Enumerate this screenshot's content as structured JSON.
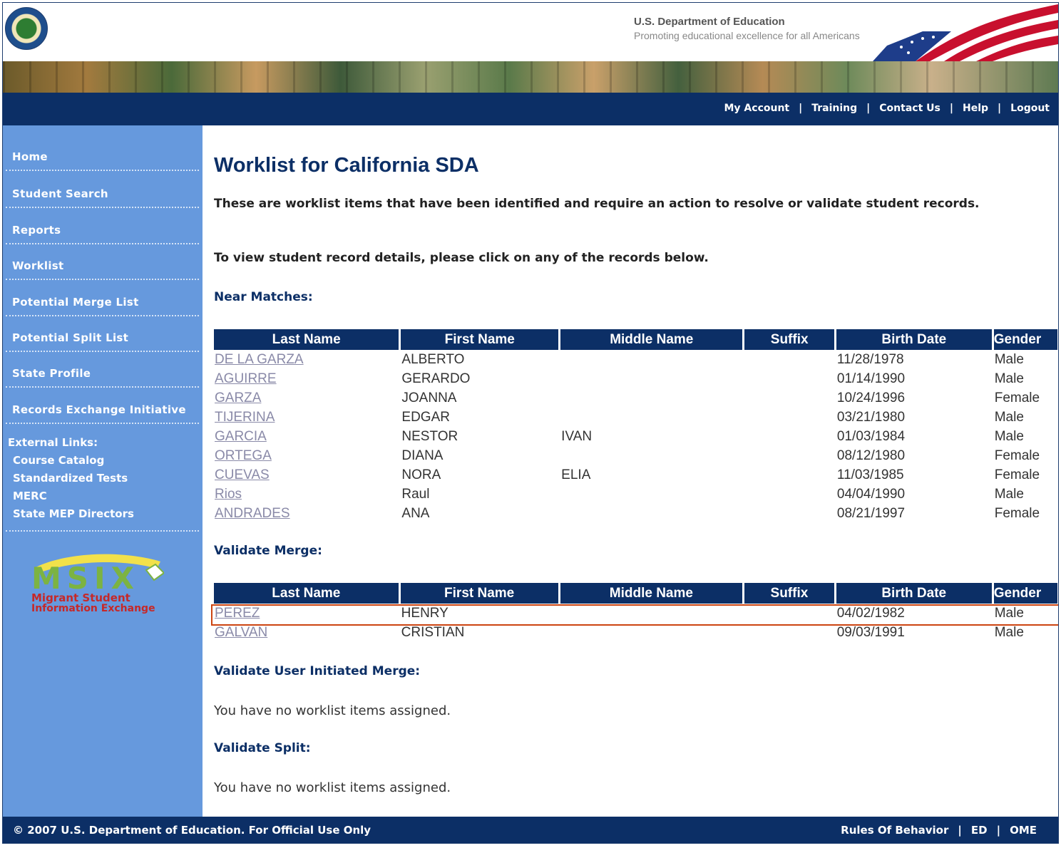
{
  "header": {
    "agency_title": "U.S. Department of Education",
    "tagline": "Promoting educational excellence for all Americans"
  },
  "topnav": {
    "links": [
      "My Account",
      "Training",
      "Contact Us",
      "Help",
      "Logout"
    ],
    "separator": "|"
  },
  "sidebar": {
    "items": [
      "Home",
      "Student Search",
      "Reports",
      "Worklist",
      "Potential Merge List",
      "Potential Split List",
      "State Profile",
      "Records Exchange Initiative"
    ],
    "external_title": "External Links:",
    "external_links": [
      "Course Catalog",
      "Standardized Tests",
      "MERC",
      "State MEP Directors"
    ],
    "logo": {
      "text": "MSIX",
      "line1": "Migrant Student",
      "line2": "Information Exchange"
    }
  },
  "main": {
    "title": "Worklist for California SDA",
    "intro": "These are worklist items that have been identified and require an action to resolve or validate student records.",
    "instructions": "To view student record details, please click on any of the records below.",
    "columns": [
      "Last Name",
      "First Name",
      "Middle Name",
      "Suffix",
      "Birth Date",
      "Gender"
    ],
    "near_matches": {
      "heading": "Near Matches:",
      "rows": [
        [
          "DE LA GARZA",
          "ALBERTO",
          "",
          "",
          "11/28/1978",
          "Male"
        ],
        [
          "AGUIRRE",
          "GERARDO",
          "",
          "",
          "01/14/1990",
          "Male"
        ],
        [
          "GARZA",
          "JOANNA",
          "",
          "",
          "10/24/1996",
          "Female"
        ],
        [
          "TIJERINA",
          "EDGAR",
          "",
          "",
          "03/21/1980",
          "Male"
        ],
        [
          "GARCIA",
          "NESTOR",
          "IVAN",
          "",
          "01/03/1984",
          "Male"
        ],
        [
          "ORTEGA",
          "DIANA",
          "",
          "",
          "08/12/1980",
          "Female"
        ],
        [
          "CUEVAS",
          "NORA",
          "ELIA",
          "",
          "11/03/1985",
          "Female"
        ],
        [
          "Rios",
          "Raul",
          "",
          "",
          "04/04/1990",
          "Male"
        ],
        [
          "ANDRADES",
          "ANA",
          "",
          "",
          "08/21/1997",
          "Female"
        ]
      ]
    },
    "validate_merge": {
      "heading": "Validate Merge:",
      "rows": [
        [
          "PEREZ",
          "HENRY",
          "",
          "",
          "04/02/1982",
          "Male"
        ],
        [
          "GALVAN",
          "CRISTIAN",
          "",
          "",
          "09/03/1991",
          "Male"
        ]
      ]
    },
    "validate_user_merge": {
      "heading": "Validate User Initiated Merge:",
      "message": "You have no worklist items assigned."
    },
    "validate_split": {
      "heading": "Validate Split:",
      "message": "You have no worklist items assigned."
    }
  },
  "footer": {
    "copyright": "© 2007 U.S. Department of Education. For Official Use Only",
    "links": [
      "Rules Of Behavior",
      "ED",
      "OME"
    ]
  },
  "colors": {
    "navy": "#0c2f66",
    "sidebar": "#6699dd",
    "link": "#8a8aa8",
    "highlight": "#cc4411"
  }
}
